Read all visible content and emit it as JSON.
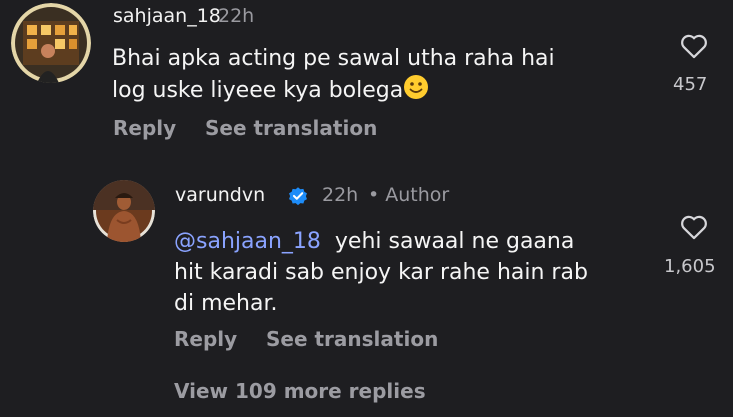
{
  "comment": {
    "username": "sahjaan_18",
    "time": "22h",
    "text_line1": "Bhai apka acting pe sawal utha raha hai",
    "text_line2": "log uske liyeee kya bolega",
    "likes": "457",
    "reply_label": "Reply",
    "translate_label": "See translation"
  },
  "reply": {
    "username": "varundvn",
    "time": "22h",
    "author_badge": "• Author",
    "mention": "@sahjaan_18",
    "text_line1": "yehi sawaal ne gaana",
    "text_line2": "hit karadi sab enjoy kar rahe hain rab",
    "text_line3": "di mehar.",
    "likes": "1,605",
    "reply_label": "Reply",
    "translate_label": "See translation"
  },
  "more_replies": "View 109 more replies",
  "icons": {
    "like": "heart-icon",
    "verified": "verified-badge-icon",
    "emoji": "smiley-emoji-icon"
  },
  "colors": {
    "background": "#1e1e21",
    "mention": "#8aa3ff",
    "verified": "#1d8cf8",
    "muted": "#9c9ca2"
  }
}
